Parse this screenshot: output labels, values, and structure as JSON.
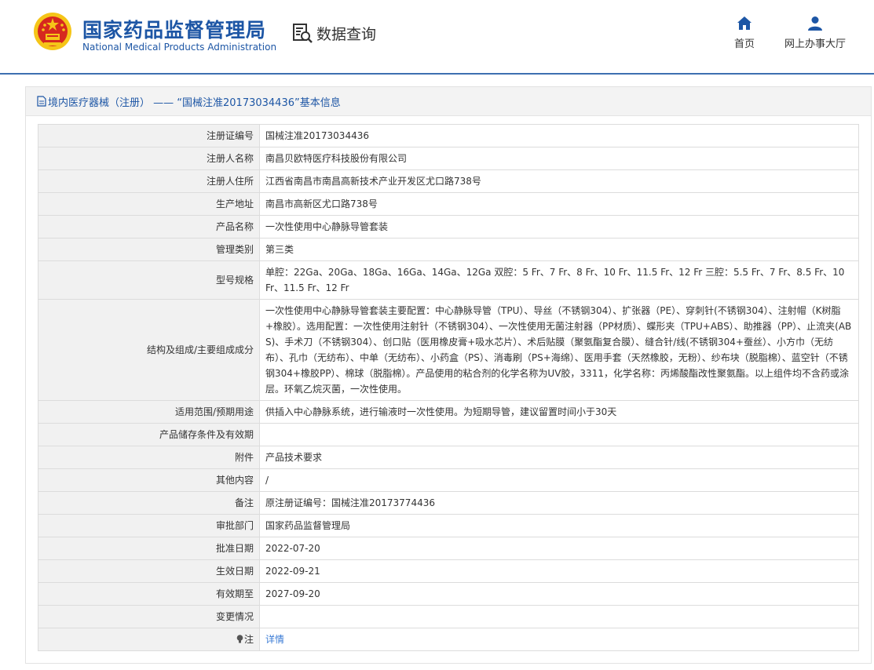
{
  "header": {
    "title": "国家药品监督管理局",
    "subtitle": "National Medical Products Administration",
    "query_label": "数据查询",
    "nav": [
      {
        "label": "首页",
        "icon": "home-icon"
      },
      {
        "label": "网上办事大厅",
        "icon": "user-icon"
      }
    ]
  },
  "panel": {
    "title": "境内医疗器械（注册） —— “国械注准20173034436”基本信息"
  },
  "rows": [
    {
      "label": "注册证编号",
      "value": "国械注准20173034436"
    },
    {
      "label": "注册人名称",
      "value": "南昌贝欧特医疗科技股份有限公司"
    },
    {
      "label": "注册人住所",
      "value": "江西省南昌市南昌高新技术产业开发区尤口路738号"
    },
    {
      "label": "生产地址",
      "value": "南昌市高新区尤口路738号"
    },
    {
      "label": "产品名称",
      "value": "一次性使用中心静脉导管套装"
    },
    {
      "label": "管理类别",
      "value": "第三类"
    },
    {
      "label": "型号规格",
      "value": "单腔：22Ga、20Ga、18Ga、16Ga、14Ga、12Ga 双腔：5 Fr、7 Fr、8 Fr、10 Fr、11.5 Fr、12 Fr 三腔：5.5 Fr、7 Fr、8.5 Fr、10 Fr、11.5 Fr、12 Fr"
    },
    {
      "label": "结构及组成/主要组成成分",
      "value": "一次性使用中心静脉导管套装主要配置：中心静脉导管（TPU）、导丝（不锈钢304）、扩张器（PE）、穿刺针(不锈钢304）、注射帽（K树脂+橡胶）。选用配置：一次性使用注射针（不锈钢304）、一次性使用无菌注射器（PP材质）、蝶形夹（TPU+ABS）、助推器（PP）、止流夹(ABS)、手术刀（不锈钢304）、创口贴（医用橡皮膏+吸水芯片）、术后贴膜（聚氨酯复合膜）、缝合针/线(不锈钢304+蚕丝）、小方巾（无纺布）、孔巾（无纺布）、中单（无纺布）、小药盒（PS）、消毒刷（PS+海绵）、医用手套（天然橡胶，无粉）、纱布块（脱脂棉）、蓝空针（不锈钢304+橡胶PP）、棉球（脱脂棉）。产品使用的粘合剂的化学名称为UV胶，3311，化学名称：丙烯酸酯改性聚氨酯。以上组件均不含药或涂层。环氧乙烷灭菌，一次性使用。"
    },
    {
      "label": "适用范围/预期用途",
      "value": "供插入中心静脉系统，进行输液时一次性使用。为短期导管，建议留置时间小于30天"
    },
    {
      "label": "产品储存条件及有效期",
      "value": ""
    },
    {
      "label": "附件",
      "value": "产品技术要求"
    },
    {
      "label": "其他内容",
      "value": "/"
    },
    {
      "label": "备注",
      "value": "原注册证编号：国械注准20173774436"
    },
    {
      "label": "审批部门",
      "value": "国家药品监督管理局"
    },
    {
      "label": "批准日期",
      "value": "2022-07-20"
    },
    {
      "label": "生效日期",
      "value": "2022-09-21"
    },
    {
      "label": "有效期至",
      "value": "2027-09-20"
    },
    {
      "label": "变更情况",
      "value": ""
    }
  ],
  "note_row": {
    "label": "注",
    "link": "详情",
    "icon": "bulb-icon"
  },
  "colors": {
    "brand_blue": "#1d56a5",
    "link_blue": "#3a7bd5",
    "label_bg": "#f1f1f1",
    "emblem_red": "#d6281f",
    "emblem_gold": "#f5c518"
  }
}
